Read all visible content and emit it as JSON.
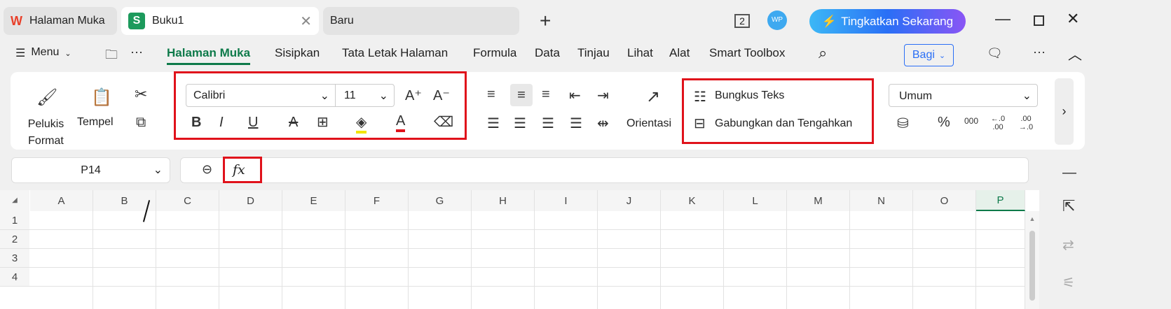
{
  "tabs": [
    {
      "label": "Halaman Muka"
    },
    {
      "label": "Buku1"
    },
    {
      "label": "Baru"
    }
  ],
  "title_bar": {
    "window_count": "2",
    "avatar": "WP",
    "upgrade_label": "Tingkatkan Sekarang"
  },
  "menu": {
    "menu_label": "Menu",
    "items": [
      "Halaman Muka",
      "Sisipkan",
      "Tata Letak Halaman",
      "Formula",
      "Data",
      "Tinjau",
      "Lihat",
      "Alat",
      "Smart Toolbox"
    ],
    "share_label": "Bagi"
  },
  "ribbon": {
    "format_painter": "Pelukis Format",
    "paste": "Tempel",
    "font": "Calibri",
    "font_size": "11",
    "orientation": "Orientasi",
    "wrap_text": "Bungkus Teks",
    "merge_center": "Gabungkan dan Tengahkan",
    "number_format": "Umum",
    "percent": "%",
    "thousands": "000",
    "inc_decimal": "←.0 .00",
    "dec_decimal": ".00 →.0"
  },
  "formula_bar": {
    "cell_ref": "P14",
    "fx": "fx",
    "value": ""
  },
  "columns": [
    "A",
    "B",
    "C",
    "D",
    "E",
    "F",
    "G",
    "H",
    "I",
    "J",
    "K",
    "L",
    "M",
    "N",
    "O",
    "P"
  ],
  "rows": [
    "1",
    "2",
    "3",
    "4"
  ],
  "colors": {
    "accent": "#0e7a4a",
    "highlight_red": "#e0121b"
  }
}
